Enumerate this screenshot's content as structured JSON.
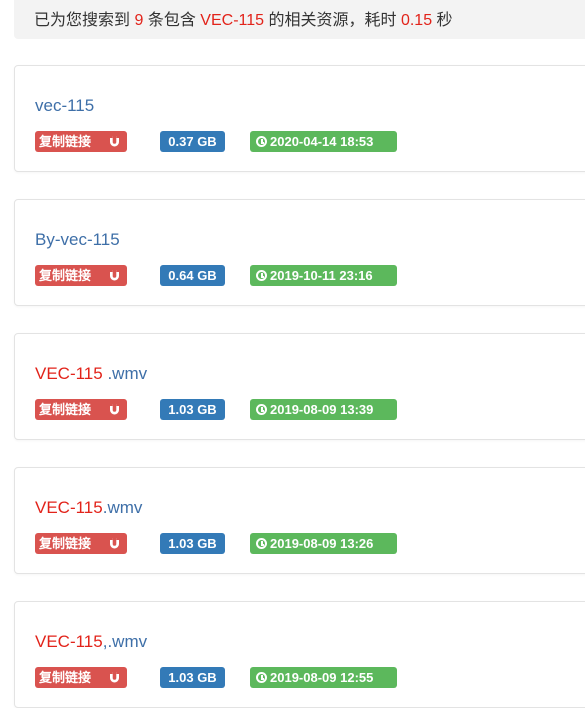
{
  "summary": {
    "prefix": "已为您搜索到",
    "count": "9",
    "middle": "条包含",
    "keyword": "VEC-115",
    "suffix": "的相关资源，耗时",
    "time": "0.15",
    "unit": "秒"
  },
  "results": [
    {
      "title_match": "",
      "title_rest": "vec-115",
      "copy_label": "复制链接",
      "size": "0.37 GB",
      "date": "2020-04-14 18:53"
    },
    {
      "title_match": "",
      "title_rest": "By-vec-115",
      "copy_label": "复制链接",
      "size": "0.64 GB",
      "date": "2019-10-11 23:16"
    },
    {
      "title_match": "VEC-115",
      "title_rest": " .wmv",
      "copy_label": "复制链接",
      "size": "1.03 GB",
      "date": "2019-08-09 13:39"
    },
    {
      "title_match": "VEC-115",
      "title_rest": ".wmv",
      "copy_label": "复制链接",
      "size": "1.03 GB",
      "date": "2019-08-09 13:26"
    },
    {
      "title_match": "VEC-115",
      "title_rest": ",.wmv",
      "copy_label": "复制链接",
      "size": "1.03 GB",
      "date": "2019-08-09 12:55"
    }
  ],
  "icons": {
    "copy": "magnet-icon",
    "date": "clock-icon"
  },
  "colors": {
    "highlight": "#e2231a",
    "link": "#3e6fa8",
    "copy": "#d9534f",
    "size": "#337ab7",
    "date": "#5cb85c"
  }
}
